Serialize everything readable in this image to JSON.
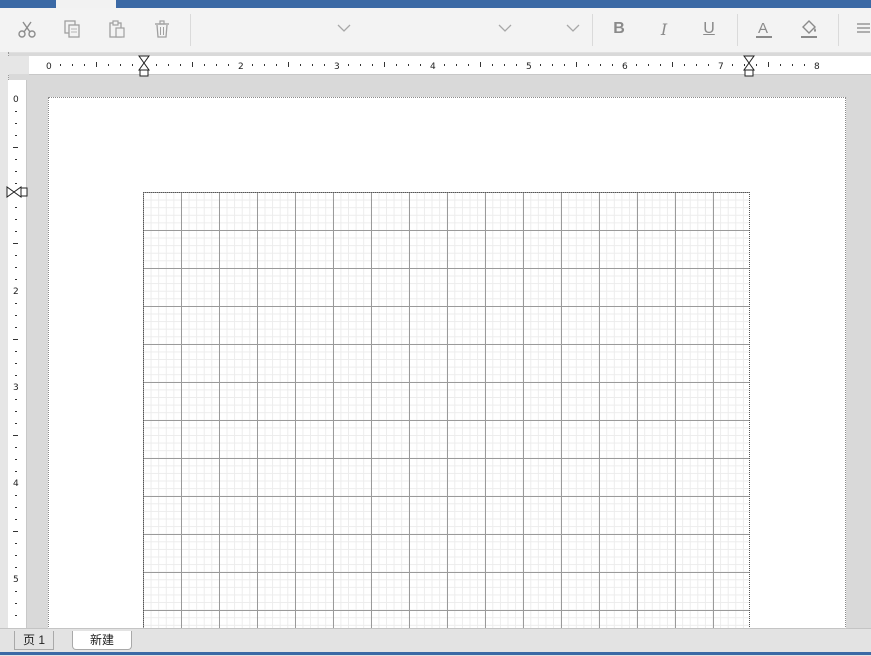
{
  "toolbar": {
    "cut_icon": "scissors-icon",
    "copy_icon": "copy-icon",
    "paste_icon": "clipboard-icon",
    "delete_icon": "trash-icon",
    "bold_label": "B",
    "italic_label": "I",
    "underline_label": "U",
    "font_color_label": "A",
    "fill_icon": "paint-bucket-icon",
    "align_icon": "align-lines-icon"
  },
  "horizontal_ruler": {
    "labels": [
      "0",
      "2",
      "3",
      "4",
      "5",
      "6",
      "7",
      "8"
    ]
  },
  "vertical_ruler": {
    "labels": [
      "0",
      "2",
      "3",
      "4",
      "5"
    ]
  },
  "page_tabs": {
    "current": "页 1",
    "new": "新建"
  },
  "colors": {
    "title_bar": "#3b69a5",
    "toolbar_bg": "#f3f3f3",
    "canvas_bg": "#d9d9d9"
  }
}
